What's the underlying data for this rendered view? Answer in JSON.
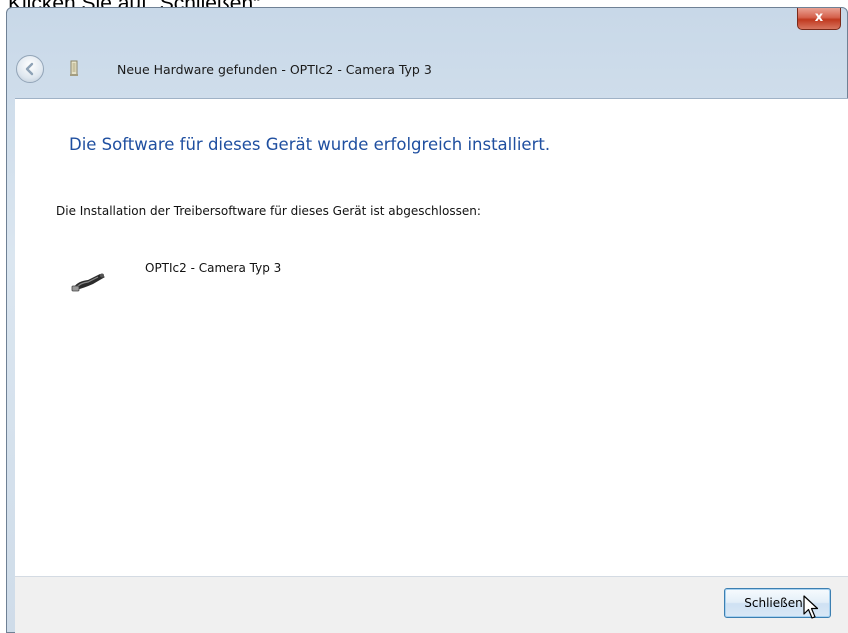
{
  "caption": "Klicken Sie auf „Schließen“",
  "window": {
    "title": "Neue Hardware gefunden - OPTIc2 - Camera Typ 3",
    "close_glyph": "x"
  },
  "content": {
    "headline": "Die Software für dieses Gerät wurde erfolgreich installiert.",
    "body": "Die Installation der Treibersoftware für dieses Gerät ist abgeschlossen:",
    "device_name": "OPTIc2 - Camera Typ 3"
  },
  "footer": {
    "close_button_label": "Schließen"
  },
  "icons": {
    "back": "back-arrow-icon",
    "hardware": "hardware-icon",
    "device": "usb-device-icon",
    "cursor": "mouse-pointer-icon"
  },
  "colors": {
    "headline": "#1f4fa0",
    "close_btn": "#c0391f",
    "button_border": "#3c7fb1"
  }
}
